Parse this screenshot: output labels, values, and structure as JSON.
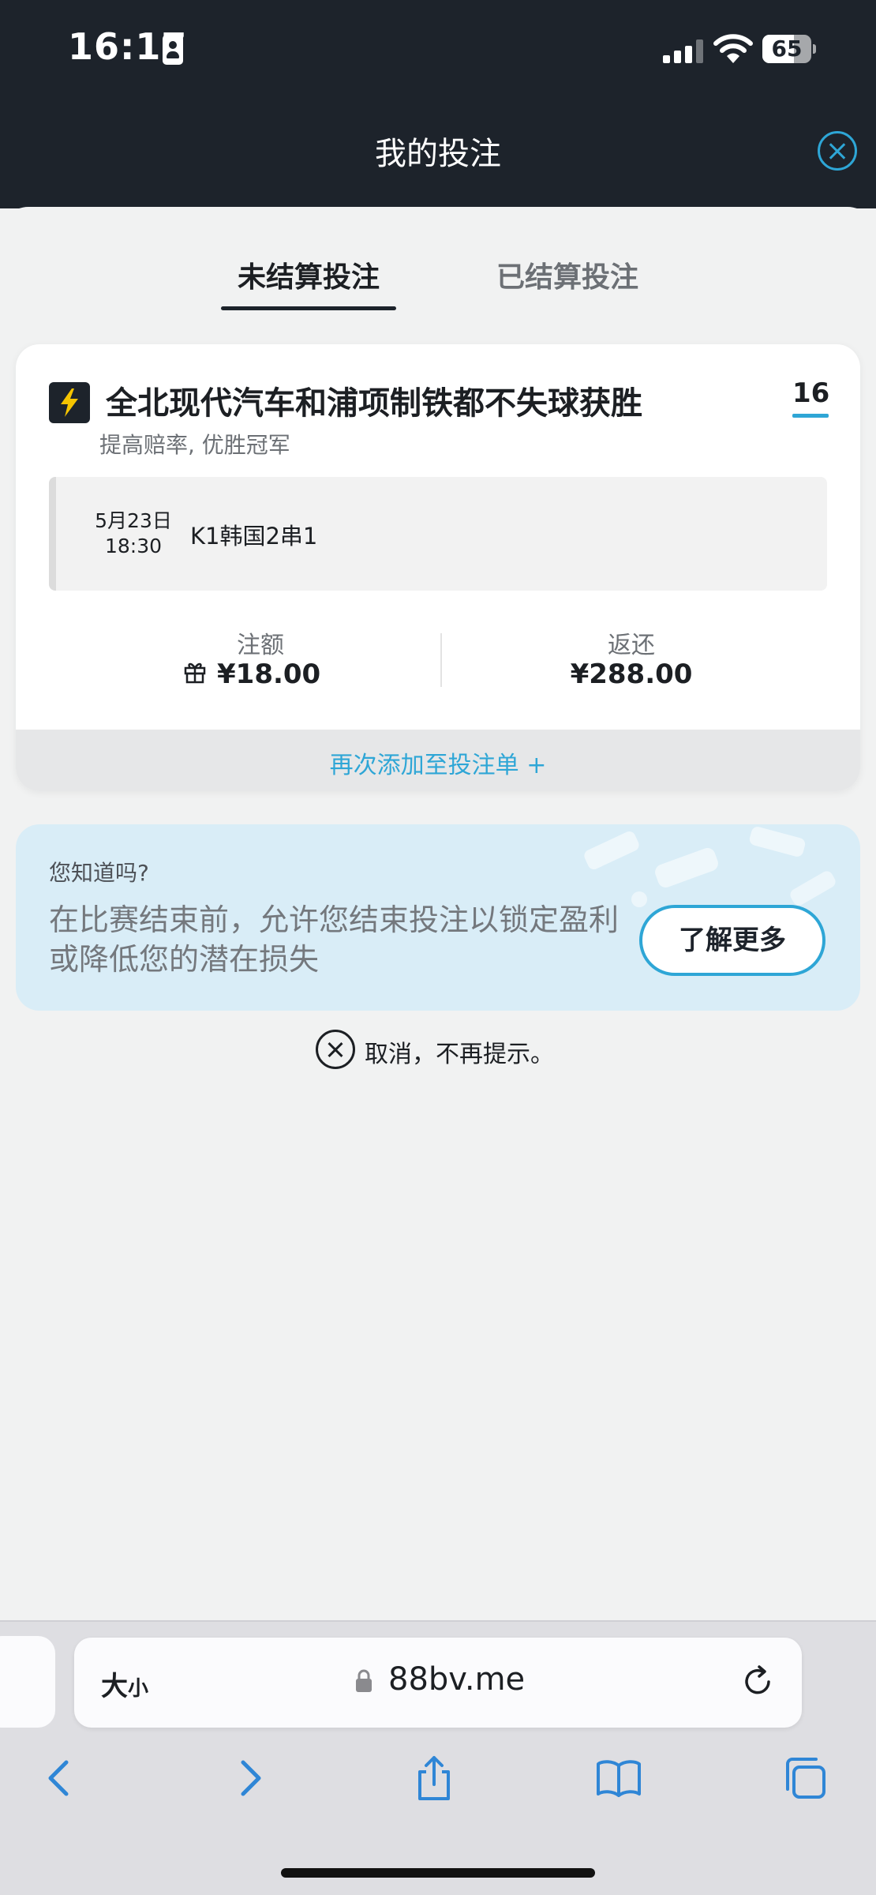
{
  "status_bar": {
    "time": "16:17",
    "battery": "65",
    "battery_fraction": 0.65
  },
  "header": {
    "title": "我的投注"
  },
  "tabs": [
    {
      "label": "未结算投注",
      "active": true
    },
    {
      "label": "已结算投注",
      "active": false
    }
  ],
  "bet": {
    "title": "全北现代汽车和浦项制铁都不失球获胜",
    "subtitle": "提高赔率, 优胜冠军",
    "count": "16",
    "date": "5月23日",
    "time": "18:30",
    "league": "K1韩国2串1",
    "stake_label": "注额",
    "stake_value": "¥18.00",
    "return_label": "返还",
    "return_value": "¥288.00",
    "readd_label": "再次添加至投注单 +"
  },
  "tip": {
    "heading": "您知道吗?",
    "body": "在比赛结束前，允许您结束投注以锁定盈利或降低您的潜在损失",
    "button": "了解更多"
  },
  "dismiss": {
    "label": "取消，不再提示。"
  },
  "browser": {
    "text_size_big": "大",
    "text_size_small": "小",
    "url": "88bv.me"
  },
  "colors": {
    "accent": "#2ea6d6",
    "header_bg": "#1d232b",
    "tip_bg": "#d9edf7",
    "bolt": "#f5c400"
  }
}
